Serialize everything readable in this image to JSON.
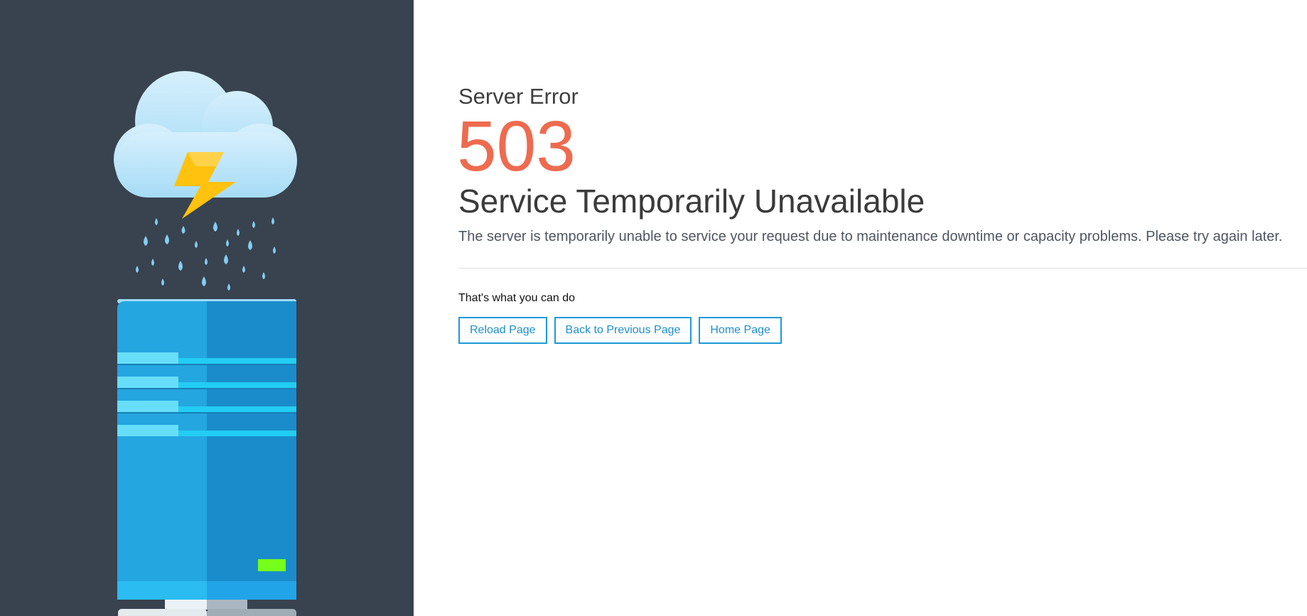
{
  "error": {
    "label": "Server Error",
    "code": "503",
    "title": "Service Temporarily Unavailable",
    "description": "The server is temporarily unable to service your request due to maintenance downtime or capacity problems. Please try again later."
  },
  "actions": {
    "heading": "That's what you can do",
    "reload": "Reload Page",
    "back": "Back to Previous Page",
    "home": "Home Page"
  },
  "illustration": {
    "icons": [
      "cloud-icon",
      "lightning-icon",
      "raindrop-icon",
      "server-icon"
    ]
  },
  "colors": {
    "left_panel": "#38434f",
    "error_code": "#ee6b4f",
    "button_border": "#1e9ad5",
    "server_light": "#24a6e0",
    "server_dark": "#1b8ccb",
    "status_led": "#76ff1a",
    "lightning": "#ffc20e",
    "cloud": "#cdebfb"
  }
}
